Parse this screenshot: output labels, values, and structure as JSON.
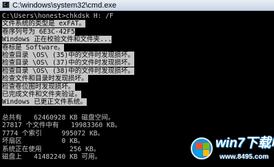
{
  "window": {
    "title": "C:\\windows\\system32\\cmd.exe",
    "icon": "cmd-icon"
  },
  "console": {
    "lines": [
      "C:\\Users\\honest>chkdsk H: /F",
      "文件系统的类型是 exFAT。",
      "卷序列号为 6E3C-42F5",
      "Windows 正在校验文件和文件夹...",
      "卷标是 Software。",
      "检查目录 \\OS\\ (35)中的文件时发现损坏。",
      "检查目录 \\OS\\ (37)中的文件时发现损坏。",
      "检查目录 \\OS\\ (38)中的文件时发现损坏。",
      "检查文件和目录时发现损坏。",
      "检查卷位图时发现损坏。",
      "已完成文件和文件夹验证。",
      "Windows 已更正文件系统。",
      "",
      "总共有   62460928 KB 磁盘空间。",
      "27817 个文件中有   19983360 KB。",
      "7774 个索引     995072 KB。",
      "坏扇区          0 KB。",
      "系统正在使用       256 KB。",
      "磁盘上   41482240 KB 可用。"
    ]
  },
  "watermark": {
    "brand": "win7下载吧",
    "url": "www.8495.com",
    "logo_icon": "windows-logo-icon"
  }
}
